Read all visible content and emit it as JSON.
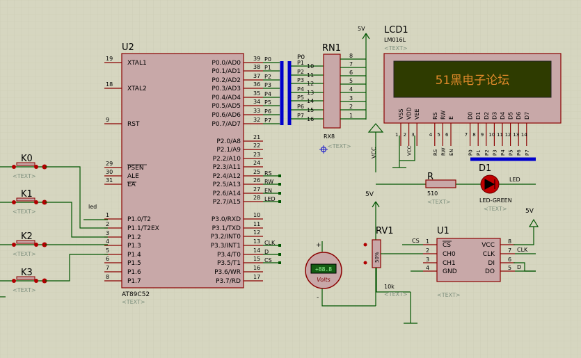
{
  "u2": {
    "ref": "U2",
    "part": "AT89C52",
    "placeholder": "<TEXT>",
    "left_pins": [
      {
        "num": "19",
        "name": "XTAL1"
      },
      {
        "num": "18",
        "name": "XTAL2"
      },
      {
        "num": "9",
        "name": "RST"
      },
      {
        "num": "29",
        "name": "PSEN"
      },
      {
        "num": "30",
        "name": "ALE"
      },
      {
        "num": "31",
        "name": "EA"
      },
      {
        "num": "1",
        "name": "P1.0/T2"
      },
      {
        "num": "2",
        "name": "P1.1/T2EX"
      },
      {
        "num": "3",
        "name": "P1.2"
      },
      {
        "num": "4",
        "name": "P1.3"
      },
      {
        "num": "5",
        "name": "P1.4"
      },
      {
        "num": "6",
        "name": "P1.5"
      },
      {
        "num": "7",
        "name": "P1.6"
      },
      {
        "num": "8",
        "name": "P1.7"
      }
    ],
    "right_pins": [
      {
        "num": "39",
        "name": "P0.0/AD0",
        "net": "P0"
      },
      {
        "num": "38",
        "name": "P0.1/AD1",
        "net": "P1"
      },
      {
        "num": "37",
        "name": "P0.2/AD2",
        "net": "P2"
      },
      {
        "num": "36",
        "name": "P0.3/AD3",
        "net": "P3"
      },
      {
        "num": "35",
        "name": "P0.4/AD4",
        "net": "P4"
      },
      {
        "num": "34",
        "name": "P0.5/AD5",
        "net": "P5"
      },
      {
        "num": "33",
        "name": "P0.6/AD6",
        "net": "P6"
      },
      {
        "num": "32",
        "name": "P0.7/AD7",
        "net": "P7"
      },
      {
        "num": "21",
        "name": "P2.0/A8",
        "net": ""
      },
      {
        "num": "22",
        "name": "P2.1/A9",
        "net": ""
      },
      {
        "num": "23",
        "name": "P2.2/A10",
        "net": ""
      },
      {
        "num": "24",
        "name": "P2.3/A11",
        "net": ""
      },
      {
        "num": "25",
        "name": "P2.4/A12",
        "net": "RS"
      },
      {
        "num": "26",
        "name": "P2.5/A13",
        "net": "RW"
      },
      {
        "num": "27",
        "name": "P2.6/A14",
        "net": "EN"
      },
      {
        "num": "28",
        "name": "P2.7/A15",
        "net": "LED"
      },
      {
        "num": "10",
        "name": "P3.0/RXD",
        "net": ""
      },
      {
        "num": "11",
        "name": "P3.1/TXD",
        "net": ""
      },
      {
        "num": "12",
        "name": "P3.2/INT0",
        "net": ""
      },
      {
        "num": "13",
        "name": "P3.3/INT1",
        "net": "CLK"
      },
      {
        "num": "14",
        "name": "P3.4/T0",
        "net": "D"
      },
      {
        "num": "15",
        "name": "P3.5/T1",
        "net": "CS"
      },
      {
        "num": "16",
        "name": "P3.6/WR",
        "net": ""
      },
      {
        "num": "17",
        "name": "P3.7/RD",
        "net": ""
      }
    ]
  },
  "rn1": {
    "ref": "RN1",
    "part": "RX8",
    "placeholder": "<TEXT>",
    "supply": "5V",
    "bus_label": "P0",
    "left_nets": [
      "P1",
      "P2",
      "P3",
      "P4",
      "P5",
      "P6",
      "P7"
    ],
    "left_pins": [
      "10",
      "11",
      "12",
      "13",
      "14",
      "15",
      "16"
    ],
    "right_pins": [
      "8",
      "7",
      "6",
      "5",
      "4",
      "3",
      "2",
      "1"
    ]
  },
  "lcd1": {
    "ref": "LCD1",
    "part": "LM016L",
    "placeholder": "<TEXT>",
    "display_text": "51黑电子论坛",
    "pin_names": [
      "VSS",
      "VDD",
      "VEE",
      "RS",
      "RW",
      "E",
      "D0",
      "D1",
      "D2",
      "D3",
      "D4",
      "D5",
      "D6",
      "D7"
    ],
    "pin_nums": [
      "1",
      "2",
      "3",
      "4",
      "5",
      "6",
      "7",
      "8",
      "9",
      "10",
      "11",
      "12",
      "13",
      "14"
    ],
    "pin_nets": [
      "",
      "VCC",
      "",
      "RS",
      "RW",
      "EN",
      "P0",
      "P1",
      "P2",
      "P3",
      "P4",
      "P5",
      "P6",
      "P7"
    ]
  },
  "keys": [
    {
      "ref": "K0",
      "placeholder": "<TEXT>"
    },
    {
      "ref": "K1",
      "placeholder": "<TEXT>"
    },
    {
      "ref": "K2",
      "placeholder": "<TEXT>"
    },
    {
      "ref": "K3",
      "placeholder": "<TEXT>"
    }
  ],
  "nets": {
    "led": "led",
    "vcc": "VCC",
    "five_v": "5V"
  },
  "r": {
    "ref": "R",
    "value": "510",
    "placeholder": "<TEXT>"
  },
  "d1": {
    "ref": "D1",
    "part": "LED-GREEN",
    "placeholder": "<TEXT>",
    "net": "LED"
  },
  "rv1": {
    "ref": "RV1",
    "value": "10k",
    "placeholder": "<TEXT>",
    "percent": "50%"
  },
  "voltmeter": {
    "reading": "+88.8",
    "unit": "Volts",
    "plus": "+",
    "minus": "-"
  },
  "u1": {
    "ref": "U1",
    "placeholder": "<TEXT>",
    "left_pins": [
      {
        "num": "1",
        "name": "CS",
        "net": "CS"
      },
      {
        "num": "2",
        "name": "CH0",
        "net": ""
      },
      {
        "num": "3",
        "name": "CH1",
        "net": ""
      },
      {
        "num": "4",
        "name": "GND",
        "net": ""
      }
    ],
    "right_pins": [
      {
        "num": "8",
        "name": "VCC",
        "net": ""
      },
      {
        "num": "7",
        "name": "CLK",
        "net": "CLK"
      },
      {
        "num": "6",
        "name": "DI",
        "net": ""
      },
      {
        "num": "5",
        "name": "DO",
        "net": "D"
      }
    ],
    "supply": "5V"
  }
}
